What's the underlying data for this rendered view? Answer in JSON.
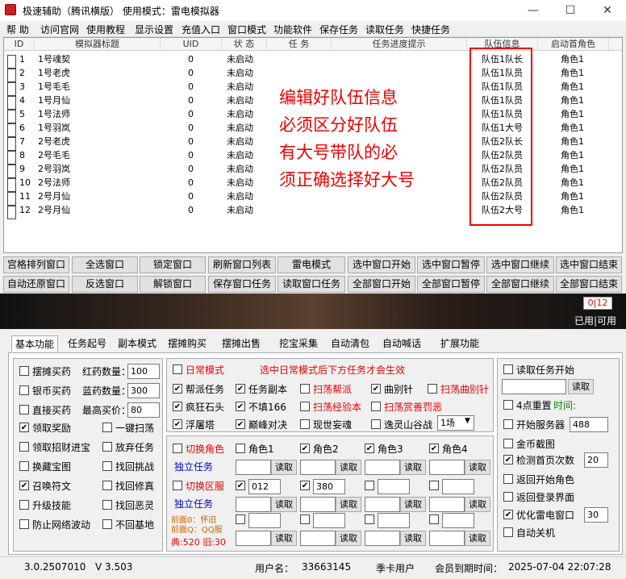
{
  "window": {
    "title": "极速辅助（腾讯横版）   使用模式：雷电模拟器",
    "min": "—",
    "max": "☐",
    "close": "✕"
  },
  "menu": [
    "帮 助",
    "访问官网",
    "使用教程",
    "显示设置",
    "充值入口",
    "窗口模式",
    "功能软件",
    "保存任务",
    "读取任务",
    "快捷任务"
  ],
  "grid": {
    "headers": [
      "ID",
      "模拟器标题",
      "UID",
      "状 态",
      "任 务",
      "任务进度提示",
      "队伍信息",
      "启动首角色"
    ],
    "rows": [
      [
        "1",
        "1号魂契",
        "0",
        "未启动",
        "队伍1队长",
        "角色1"
      ],
      [
        "2",
        "1号老虎",
        "0",
        "未启动",
        "队伍1队员",
        "角色1"
      ],
      [
        "3",
        "1号毛毛",
        "0",
        "未启动",
        "队伍1队员",
        "角色1"
      ],
      [
        "4",
        "1号月仙",
        "0",
        "未启动",
        "队伍1队员",
        "角色1"
      ],
      [
        "5",
        "1号法师",
        "0",
        "未启动",
        "队伍1队员",
        "角色1"
      ],
      [
        "6",
        "1号羽岚",
        "0",
        "未启动",
        "队伍1大号",
        "角色1"
      ],
      [
        "7",
        "2号老虎",
        "0",
        "未启动",
        "队伍2队长",
        "角色1"
      ],
      [
        "8",
        "2号毛毛",
        "0",
        "未启动",
        "队伍2队员",
        "角色1"
      ],
      [
        "9",
        "2号羽岚",
        "0",
        "未启动",
        "队伍2队员",
        "角色1"
      ],
      [
        "10",
        "2号法师",
        "0",
        "未启动",
        "队伍2队员",
        "角色1"
      ],
      [
        "11",
        "2号月仙",
        "0",
        "未启动",
        "队伍2队员",
        "角色1"
      ],
      [
        "12",
        "2号月仙",
        "0",
        "未启动",
        "队伍2大号",
        "角色1"
      ]
    ],
    "annotation": [
      "编辑好队伍信息",
      "必须区分好队伍",
      "有大号带队的必",
      "须正确选择好大号"
    ]
  },
  "buttons_row1": [
    "宫格排列窗口",
    "全选窗口",
    "锁定窗口",
    "刷新窗口列表",
    "雷电模式",
    "选中窗口开始",
    "选中窗口暂停",
    "选中窗口继续",
    "选中窗口结束"
  ],
  "buttons_row2": [
    "自动还原窗口",
    "反选窗口",
    "解锁窗口",
    "保存窗口任务",
    "读取窗口任务",
    "全部窗口开始",
    "全部窗口暂停",
    "全部窗口继续",
    "全部窗口结束"
  ],
  "counter": "0|12",
  "counter_label": "已用|可用",
  "tabs": [
    "基本功能",
    "任务起号",
    "副本模式",
    "摆摊购买",
    "摆摊出售",
    "挖宝采集",
    "自动清包",
    "自动喊话",
    "扩展功能"
  ],
  "basic": {
    "buy_red": "摆摊买药",
    "red_qty_label": "红药数量：",
    "red_qty": "100",
    "silver_buy": "银币买药",
    "blue_qty_label": "蓝药数量：",
    "blue_qty": "300",
    "direct_buy": "直接买药",
    "max_price_label": "最高买价：",
    "max_price": "80",
    "left": [
      [
        "领取奖励",
        true
      ],
      [
        "领取招财进宝",
        false
      ],
      [
        "换藏宝图",
        false
      ],
      [
        "召唤符文",
        true
      ],
      [
        "升级技能",
        false
      ],
      [
        "防止网络波动",
        false
      ]
    ],
    "right": [
      [
        "一键扫荡",
        false
      ],
      [
        "放弃任务",
        false
      ],
      [
        "找回挑战",
        false
      ],
      [
        "找回修真",
        false
      ],
      [
        "找回恶灵",
        false
      ],
      [
        "不回基地",
        false
      ]
    ]
  },
  "daily": {
    "mode": "日常模式",
    "hint": "选中日常模式后下方任务才会生效",
    "items": [
      [
        "帮派任务",
        true,
        "b"
      ],
      [
        "任务副本",
        true,
        "b"
      ],
      [
        "扫荡帮派",
        false,
        "r"
      ],
      [
        "曲别针",
        true,
        "b"
      ],
      [
        "扫荡曲别针",
        false,
        "r"
      ],
      [
        "疯狂石头",
        true,
        "b"
      ],
      [
        "不填166",
        true,
        "b"
      ],
      [
        "扫荡经验本",
        false,
        "r"
      ],
      [
        "扫荡赏善罚恶",
        false,
        "r"
      ],
      [
        "浮屠塔",
        true,
        "b"
      ],
      [
        "巅峰对决",
        true,
        "b"
      ],
      [
        "现世妄魂",
        false,
        "b"
      ],
      [
        "逸灵山谷战",
        false,
        "b"
      ]
    ],
    "select": "1场"
  },
  "roles": {
    "switch_role": "切换角色",
    "indep1": "独立任务",
    "switch_zone": "切换区服",
    "indep2": "独立任务",
    "role_names": [
      "角色1",
      "角色2",
      "角色3",
      "角色4"
    ],
    "role_checked": [
      false,
      true,
      true,
      true
    ],
    "read": "读取",
    "zone1": "012",
    "zone2": "380",
    "front": "前面0：怀旧",
    "front2": "前面Q：QQ服",
    "front3": "典:520  旧:30"
  },
  "right": {
    "read_task": "读取任务开始",
    "read_btn": "读取",
    "reset": "4点重置",
    "time": "时间:",
    "start_server": "开始服务器",
    "server_val": "488",
    "screenshot": "金币截图",
    "detect": "检测首页次数",
    "detect_val": "20",
    "return_role": "返回开始角色",
    "return_login": "返回登录界面",
    "optimize": "优化雷电窗口",
    "opt_val": "30",
    "auto_off": "自动关机"
  },
  "status": {
    "version": "3.0.2507010",
    "v": "V 3.503",
    "user_label": "用户名：",
    "user": "33663145",
    "card": "季卡用户",
    "expire_label": "会员到期时间：",
    "expire": "2025-07-04  22:07:28"
  }
}
